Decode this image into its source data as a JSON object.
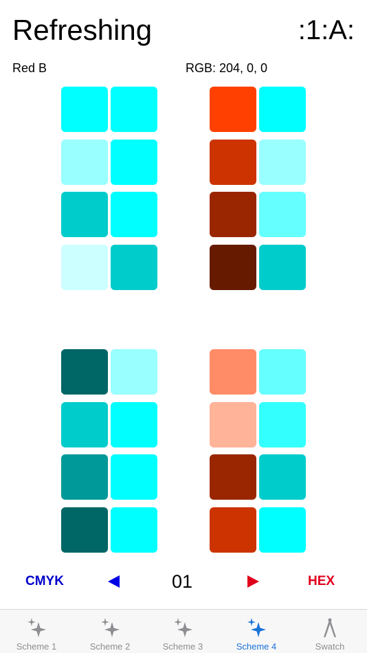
{
  "header": {
    "title": "Refreshing",
    "logo_text": ":1:A:"
  },
  "info": {
    "color_name": "Red B",
    "rgb_text": "RGB: 204, 0, 0"
  },
  "swatches": {
    "top_left": [
      [
        "#00ffff",
        "#00ffff"
      ],
      [
        "#99ffff",
        "#00ffff"
      ],
      [
        "#00cccc",
        "#00ffff"
      ],
      [
        "#ccffff",
        "#00cccc"
      ]
    ],
    "top_right": [
      [
        "#ff4000",
        "#00ffff"
      ],
      [
        "#cc3300",
        "#99ffff"
      ],
      [
        "#992600",
        "#66ffff"
      ],
      [
        "#661a00",
        "#00cccc"
      ]
    ],
    "bottom_left": [
      [
        "#006666",
        "#99ffff"
      ],
      [
        "#00cccc",
        "#00ffff"
      ],
      [
        "#009999",
        "#00ffff"
      ],
      [
        "#006666",
        "#00ffff"
      ]
    ],
    "bottom_right": [
      [
        "#ff8c66",
        "#66ffff"
      ],
      [
        "#ffb399",
        "#33ffff"
      ],
      [
        "#992600",
        "#00cccc"
      ],
      [
        "#cc3300",
        "#00ffff"
      ]
    ]
  },
  "nav": {
    "cmyk_label": "CMYK",
    "page_number": "01",
    "hex_label": "HEX",
    "prev_icon": "left-triangle-icon",
    "next_icon": "right-triangle-icon"
  },
  "tabs": [
    {
      "label": "Scheme 1",
      "icon": "sparkles-icon",
      "active": false
    },
    {
      "label": "Scheme 2",
      "icon": "sparkles-icon",
      "active": false
    },
    {
      "label": "Scheme 3",
      "icon": "sparkles-icon",
      "active": false
    },
    {
      "label": "Scheme 4",
      "icon": "sparkles-icon",
      "active": true
    },
    {
      "label": "Swatch",
      "icon": "compass-icon",
      "active": false
    }
  ],
  "colors": {
    "accent_blue": "#1a73d9",
    "cmyk_blue": "#0000cc",
    "hex_red": "#e0001b",
    "tab_inactive": "#8e8e93"
  }
}
